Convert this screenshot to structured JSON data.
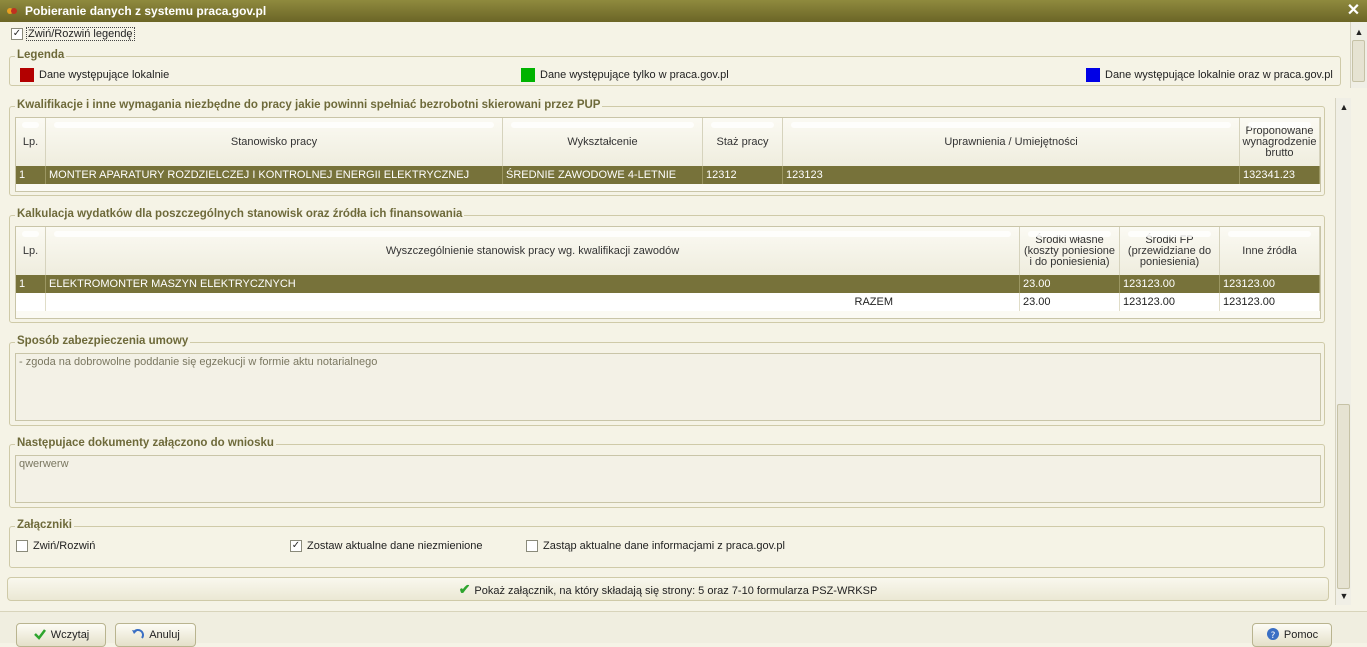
{
  "window": {
    "title": "Pobieranie danych z systemu praca.gov.pl",
    "close_icon": "close-icon"
  },
  "legend_toggle": {
    "label": "Zwiń/Rozwiń legendę",
    "checked": true
  },
  "legend": {
    "title": "Legenda",
    "items": [
      {
        "label": "Dane występujące lokalnie",
        "color": "#b30000"
      },
      {
        "label": "Dane występujące tylko w praca.gov.pl",
        "color": "#00b300"
      },
      {
        "label": "Dane występujące lokalnie oraz w praca.gov.pl",
        "color": "#0000e6"
      }
    ]
  },
  "qualifications": {
    "title": "Kwalifikacje i inne wymagania niezbędne do pracy jakie powinni spełniać bezrobotni skierowani przez PUP",
    "headers": [
      "Lp.",
      "Stanowisko pracy",
      "Wykształcenie",
      "Staż pracy",
      "Uprawnienia / Umiejętności",
      "Proponowane wynagrodzenie brutto"
    ],
    "rows": [
      [
        "1",
        "MONTER APARATURY ROZDZIELCZEJ I KONTROLNEJ ENERGII ELEKTRYCZNEJ",
        "ŚREDNIE ZAWODOWE 4-LETNIE",
        "12312",
        "123123",
        "132341.23"
      ]
    ]
  },
  "calculation": {
    "title": "Kalkulacja wydatków dla poszczególnych stanowisk oraz źródła ich finansowania",
    "headers": [
      "Lp.",
      "Wyszczególnienie stanowisk pracy wg. kwalifikacji zawodów",
      "Środki własne (koszty poniesione i do poniesienia)",
      "Środki FP (przewidziane do poniesienia)",
      "Inne źródła"
    ],
    "rows": [
      [
        "1",
        "ELEKTROMONTER MASZYN ELEKTRYCZNYCH",
        "23.00",
        "123123.00",
        "123123.00"
      ]
    ],
    "total": {
      "label": "RAZEM",
      "own": "23.00",
      "fp": "123123.00",
      "other": "123123.00"
    }
  },
  "security": {
    "title": "Sposób zabezpieczenia umowy",
    "text": "- zgoda na dobrowolne poddanie się egzekucji w formie aktu notarialnego"
  },
  "documents": {
    "title": "Następujace dokumenty załączono do wniosku",
    "text": "qwerwerw"
  },
  "attachments": {
    "title": "Załączniki",
    "options": [
      {
        "label": "Zwiń/Rozwiń",
        "checked": false
      },
      {
        "label": "Zostaw aktualne dane niezmienione",
        "checked": true
      },
      {
        "label": "Zastąp aktualne dane informacjami z praca.gov.pl",
        "checked": false
      }
    ]
  },
  "show_attachment": {
    "label": "Pokaż załącznik, na który składają się strony: 5 oraz 7-10 formularza PSZ-WRKSP"
  },
  "buttons": {
    "load": "Wczytaj",
    "cancel": "Anuluj",
    "help": "Pomoc"
  }
}
